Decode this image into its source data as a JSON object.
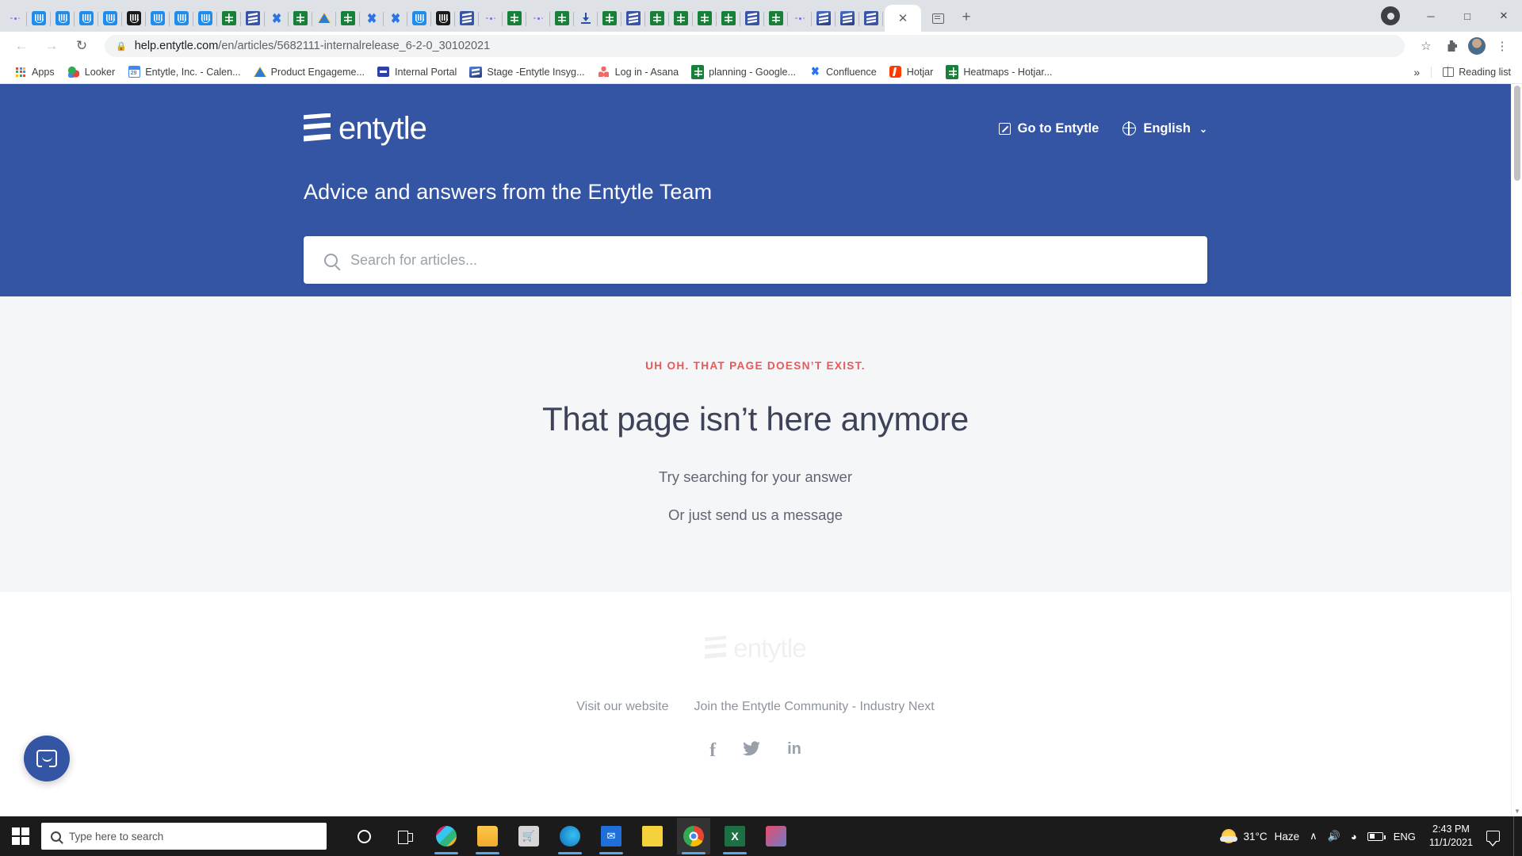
{
  "browser": {
    "tabs_favicons": [
      "dots-icon",
      "intercom-icon",
      "intercom-icon",
      "intercom-icon",
      "intercom-icon",
      "intercom-dark-icon",
      "intercom-icon",
      "intercom-icon",
      "intercom-icon",
      "sheets-icon",
      "entytle-icon",
      "confluence-icon",
      "sheets-icon",
      "drive-icon",
      "sheets-icon",
      "confluence-icon",
      "confluence-icon",
      "intercom-icon",
      "intercom-dark-icon",
      "entytle-icon",
      "dots-icon",
      "sheets-icon",
      "dots-icon",
      "sheets-icon",
      "download-icon",
      "sheets-icon",
      "entytle-icon",
      "sheets-icon",
      "sheets-icon",
      "sheets-icon",
      "sheets-icon",
      "entytle-icon",
      "sheets-icon",
      "dots-icon",
      "entytle-grad-icon",
      "entytle-grad-icon",
      "entytle-icon"
    ],
    "active_tab_close": "✕",
    "tab_search_icon": "tab-search-icon",
    "new_tab": "+",
    "window_controls": {
      "minimize": "─",
      "maximize": "□",
      "close": "✕"
    },
    "toolbar": {
      "back": "←",
      "forward": "→",
      "reload": "↻",
      "lock": "🔒",
      "url_domain": "help.entytle.com",
      "url_path": "/en/articles/5682111-internalrelease_6-2-0_30102021",
      "star": "☆",
      "extensions": "🧩",
      "menu": "⋮"
    },
    "bookmarks": [
      {
        "label": "Apps",
        "icon": "apps-grid-icon"
      },
      {
        "label": "Looker",
        "icon": "looker-icon"
      },
      {
        "label": "Entytle, Inc. - Calen...",
        "icon": "google-calendar-icon"
      },
      {
        "label": "Product Engageme...",
        "icon": "google-drive-icon"
      },
      {
        "label": "Internal Portal",
        "icon": "portal-icon"
      },
      {
        "label": "Stage -Entytle Insyg...",
        "icon": "entytle-icon"
      },
      {
        "label": "Log in - Asana",
        "icon": "asana-icon"
      },
      {
        "label": "planning - Google...",
        "icon": "google-sheets-icon"
      },
      {
        "label": "Confluence",
        "icon": "confluence-icon"
      },
      {
        "label": "Hotjar",
        "icon": "hotjar-icon"
      },
      {
        "label": "Heatmaps - Hotjar...",
        "icon": "google-sheets-icon"
      }
    ],
    "bookmarks_overflow": "»",
    "reading_list": "Reading list"
  },
  "hero": {
    "logo_text": "entytle",
    "nav": {
      "go_to_entytle": "Go to Entytle",
      "language": "English",
      "language_chevron": "⌄"
    },
    "tagline": "Advice and answers from the Entytle Team",
    "search_placeholder": "Search for articles...",
    "search_value": "",
    "background_color": "#3454a4"
  },
  "error": {
    "kicker": "UH OH. THAT PAGE DOESN’T EXIST.",
    "kicker_color": "#eb5757",
    "title": "That page isn’t here anymore",
    "line1": "Try searching for your answer",
    "line2": "Or just send us a message"
  },
  "footer": {
    "logo_text": "entytle",
    "links": [
      "Visit our website",
      "Join the Entytle Community - Industry Next"
    ],
    "social": [
      {
        "name": "facebook-icon",
        "glyph": "f"
      },
      {
        "name": "twitter-icon",
        "glyph": "🐦"
      },
      {
        "name": "linkedin-icon",
        "glyph": "in"
      }
    ]
  },
  "messenger": {
    "launcher_icon": "intercom-messenger-icon"
  },
  "taskbar": {
    "start": "windows-logo-icon",
    "search_placeholder": "Type here to search",
    "apps": [
      {
        "name": "cortana-icon"
      },
      {
        "name": "task-view-icon"
      },
      {
        "name": "slack-icon"
      },
      {
        "name": "file-explorer-icon"
      },
      {
        "name": "microsoft-store-icon"
      },
      {
        "name": "microsoft-edge-icon"
      },
      {
        "name": "mail-icon"
      },
      {
        "name": "sticky-notes-icon"
      },
      {
        "name": "google-chrome-icon"
      },
      {
        "name": "excel-icon"
      },
      {
        "name": "snipping-tool-icon"
      }
    ],
    "weather": {
      "temp": "31°C",
      "condition": "Haze"
    },
    "tray": {
      "chevron": "∧",
      "volume": "volume-icon",
      "wifi": "wifi-icon",
      "battery": "battery-charging-icon",
      "language": "ENG"
    },
    "clock": {
      "time": "2:43 PM",
      "date": "11/1/2021"
    },
    "notifications": "notification-icon"
  }
}
